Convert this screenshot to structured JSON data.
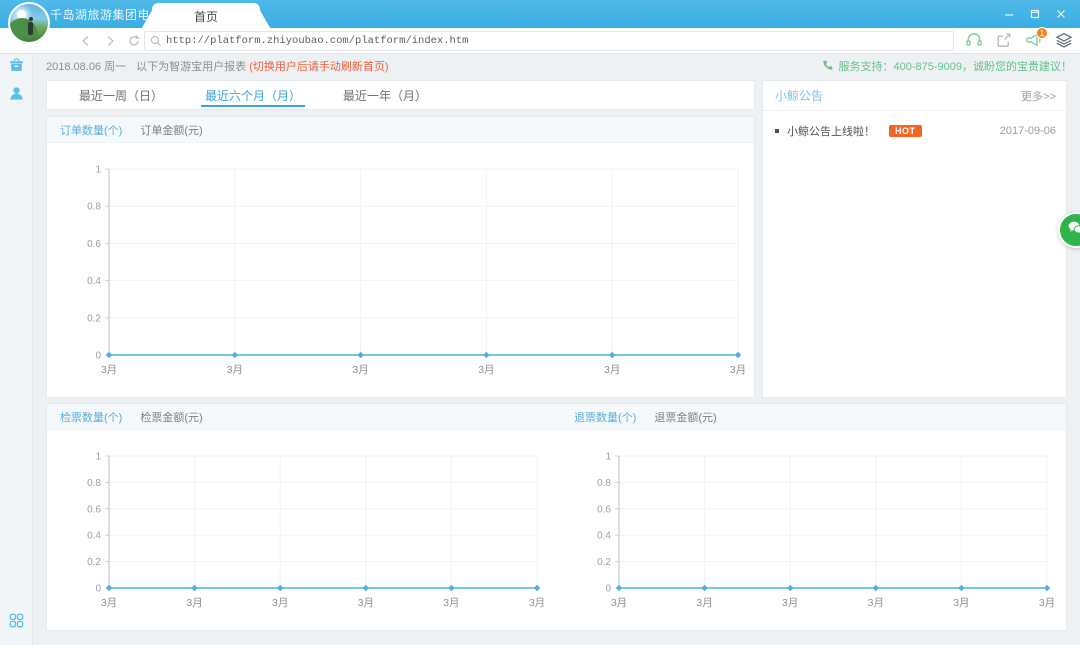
{
  "browser": {
    "brand": "千岛湖旅游集团电",
    "tab_label": "首页",
    "url": "http://platform.zhiyoubao.com/platform/index.htm",
    "window_controls": {
      "minimize": "minimize-icon",
      "maximize": "maximize-icon",
      "close": "close-icon"
    },
    "nav": {
      "back": "back-arrow-icon",
      "forward": "forward-arrow-icon",
      "reload": "reload-icon"
    },
    "toolbar_icons": [
      {
        "name": "headset-icon",
        "badge": ""
      },
      {
        "name": "share-icon",
        "badge": ""
      },
      {
        "name": "megaphone-icon",
        "badge": "1"
      },
      {
        "name": "layers-icon",
        "badge": ""
      }
    ]
  },
  "sidebar": {
    "items": [
      {
        "name": "sidebar-item-archive",
        "icon": "archive-box-icon"
      },
      {
        "name": "sidebar-item-user",
        "icon": "user-icon"
      }
    ],
    "bottom": {
      "name": "sidebar-item-apps",
      "icon": "grid-apps-icon"
    }
  },
  "infobar": {
    "date": "2018.08.06 周一",
    "description": "以下为智游宝用户报表",
    "note": "(切换用户后请手动刷新首页)",
    "support": "服务支持：400-875-9009，诚盼您的宝贵建议！",
    "support_icon": "phone-icon"
  },
  "period_tabs": [
    {
      "label": "最近一周（日）",
      "active": false
    },
    {
      "label": "最近六个月（月）",
      "active": true
    },
    {
      "label": "最近一年（月）",
      "active": false
    }
  ],
  "order_panel": {
    "tabs": [
      {
        "label": "订单数量(个)",
        "active": true
      },
      {
        "label": "订单金额(元)",
        "active": false
      }
    ]
  },
  "notice_panel": {
    "title": "小鲸公告",
    "more": "更多>>",
    "items": [
      {
        "text": "小鲸公告上线啦！",
        "badge": "HOT",
        "date": "2017-09-06"
      }
    ]
  },
  "bottom_panel": {
    "left_tabs": [
      {
        "label": "检票数量(个)",
        "active": true
      },
      {
        "label": "检票金额(元)",
        "active": false
      }
    ],
    "right_tabs": [
      {
        "label": "退票数量(个)",
        "active": true
      },
      {
        "label": "退票金额(元)",
        "active": false
      }
    ]
  },
  "float_widget": {
    "name": "customer-service-widget",
    "icon": "wechat-icon"
  },
  "colors": {
    "accent": "#3ba3dd",
    "chart_line": "#4fb0e0",
    "hot_badge": "#f26522",
    "support_green": "#65c08a",
    "title_bar": "#3aaee2"
  },
  "chart_data": [
    {
      "id": "order-chart",
      "type": "line",
      "title": "订单数量(个)",
      "xlabel": "",
      "ylabel": "",
      "categories": [
        "3月",
        "3月",
        "3月",
        "3月",
        "3月",
        "3月"
      ],
      "values": [
        0,
        0,
        0,
        0,
        0,
        0
      ],
      "ylim": [
        0,
        1
      ],
      "yticks": [
        0,
        0.2,
        0.4,
        0.6,
        0.8,
        1
      ],
      "ytick_labels": [
        "0",
        "0.2",
        "0.4",
        "0.6",
        "0.8",
        "1"
      ],
      "grid": true,
      "legend": "none",
      "line_color": "#4fb0e0",
      "marker": "diamond"
    },
    {
      "id": "check-chart",
      "type": "line",
      "title": "检票数量(个)",
      "xlabel": "",
      "ylabel": "",
      "categories": [
        "3月",
        "3月",
        "3月",
        "3月",
        "3月",
        "3月"
      ],
      "values": [
        0,
        0,
        0,
        0,
        0,
        0
      ],
      "ylim": [
        0,
        1
      ],
      "yticks": [
        0,
        0.2,
        0.4,
        0.6,
        0.8,
        1
      ],
      "ytick_labels": [
        "0",
        "0.2",
        "0.4",
        "0.6",
        "0.8",
        "1"
      ],
      "grid": true,
      "legend": "none",
      "line_color": "#4fb0e0",
      "marker": "diamond"
    },
    {
      "id": "refund-chart",
      "type": "line",
      "title": "退票数量(个)",
      "xlabel": "",
      "ylabel": "",
      "categories": [
        "3月",
        "3月",
        "3月",
        "3月",
        "3月",
        "3月"
      ],
      "values": [
        0,
        0,
        0,
        0,
        0,
        0
      ],
      "ylim": [
        0,
        1
      ],
      "yticks": [
        0,
        0.2,
        0.4,
        0.6,
        0.8,
        1
      ],
      "ytick_labels": [
        "0",
        "0.2",
        "0.4",
        "0.6",
        "0.8",
        "1"
      ],
      "grid": true,
      "legend": "none",
      "line_color": "#4fb0e0",
      "marker": "diamond"
    }
  ]
}
